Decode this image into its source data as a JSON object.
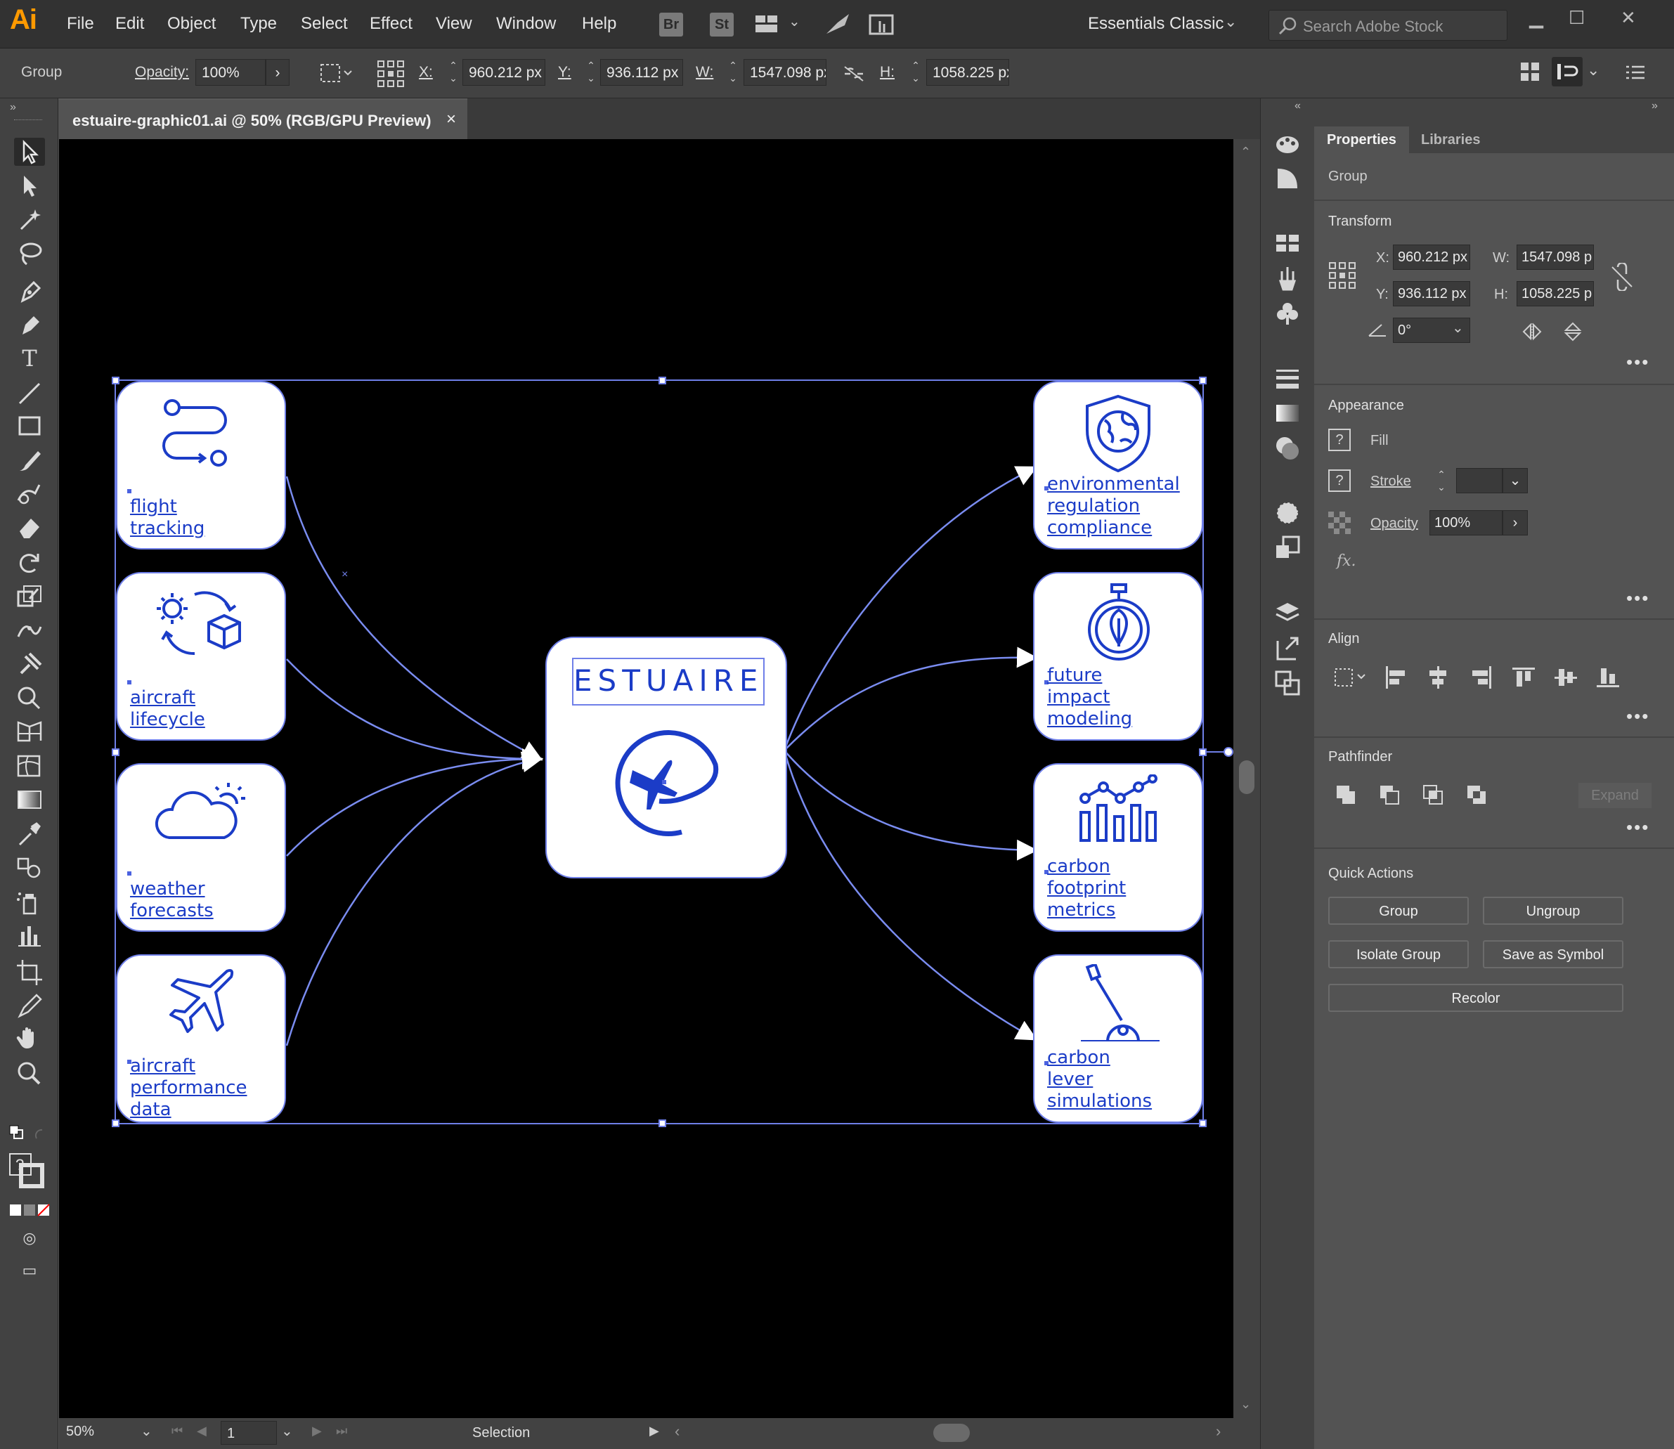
{
  "app": {
    "logo": "Ai",
    "menu": [
      "File",
      "Edit",
      "Object",
      "Type",
      "Select",
      "Effect",
      "View",
      "Window",
      "Help"
    ],
    "bridge_label": "Br",
    "stock_label": "St",
    "workspace": "Essentials Classic",
    "search_placeholder": "Search Adobe Stock"
  },
  "control_bar": {
    "selection_type": "Group",
    "opacity_label": "Opacity:",
    "opacity": "100%",
    "x_label": "X:",
    "x": "960.212 px",
    "y_label": "Y:",
    "y": "936.112 px",
    "w_label": "W:",
    "w": "1547.098 px",
    "h_label": "H:",
    "h": "1058.225 px"
  },
  "document": {
    "tab_title": "estuaire-graphic01.ai @ 50% (RGB/GPU Preview)",
    "close": "×"
  },
  "status": {
    "zoom": "50%",
    "artboard": "1",
    "tool": "Selection"
  },
  "panel": {
    "tabs": [
      "Properties",
      "Libraries"
    ],
    "object_type": "Group",
    "transform": {
      "title": "Transform",
      "x_label": "X:",
      "x": "960.212 px",
      "y_label": "Y:",
      "y": "936.112 px",
      "w_label": "W:",
      "w": "1547.098 p",
      "h_label": "H:",
      "h": "1058.225 p",
      "angle": "0°"
    },
    "appearance": {
      "title": "Appearance",
      "fill_label": "Fill",
      "stroke_label": "Stroke",
      "opacity_label": "Opacity",
      "opacity": "100%",
      "fx": "fx."
    },
    "align_title": "Align",
    "pathfinder": {
      "title": "Pathfinder",
      "expand": "Expand"
    },
    "quick_actions": {
      "title": "Quick Actions",
      "group": "Group",
      "ungroup": "Ungroup",
      "isolate": "Isolate Group",
      "save_symbol": "Save as Symbol",
      "recolor": "Recolor"
    }
  },
  "artwork": {
    "brand": "ESTUAIRE",
    "accent_color": "#1b3cc7",
    "selection_color": "#6f7fe8",
    "inputs": [
      {
        "label": "flight\ntracking",
        "icon": "route-icon"
      },
      {
        "label": "aircraft\nlifecycle",
        "icon": "gear-cycle-icon"
      },
      {
        "label": "weather\nforecasts",
        "icon": "cloud-sun-icon"
      },
      {
        "label": "aircraft\nperformance\ndata",
        "icon": "airplane-icon"
      }
    ],
    "outputs": [
      {
        "label": "environmental\nregulation\ncompliance",
        "icon": "shield-globe-icon"
      },
      {
        "label": "future\nimpact\nmodeling",
        "icon": "stopwatch-leaf-icon"
      },
      {
        "label": "carbon\nfootprint\nmetrics",
        "icon": "bar-chart-icon"
      },
      {
        "label": "carbon\nlever\nsimulations",
        "icon": "lever-icon"
      }
    ]
  }
}
